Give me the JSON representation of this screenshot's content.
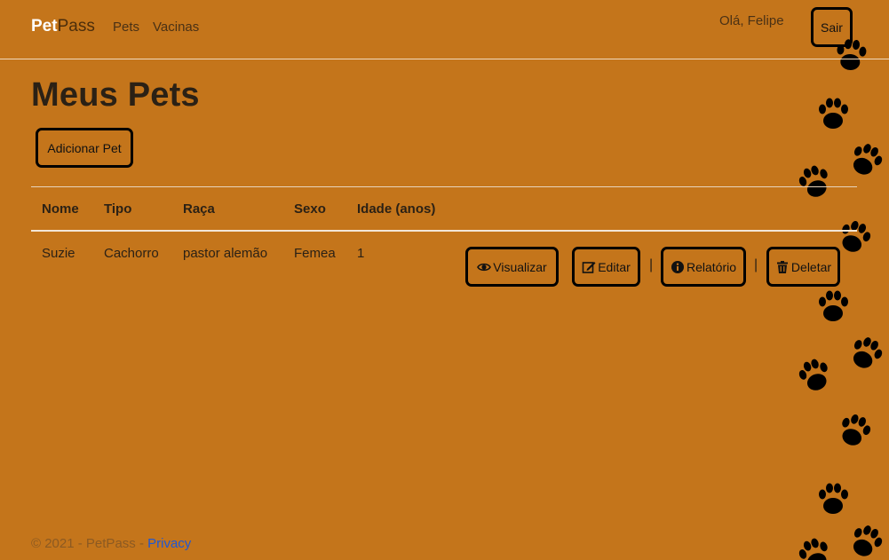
{
  "navbar": {
    "brand_bold": "Pet",
    "brand_rest": "Pass",
    "links": [
      "Pets",
      "Vacinas"
    ],
    "greeting": "Olá, Felipe",
    "logout_label": "Sair"
  },
  "page": {
    "title": "Meus Pets",
    "add_button_label": "Adicionar Pet"
  },
  "table": {
    "headers": [
      "Nome",
      "Tipo",
      "Raça",
      "Sexo",
      "Idade (anos)"
    ],
    "rows": [
      {
        "cells": [
          "Suzie",
          "Cachorro",
          "pastor alemão",
          "Femea",
          "1"
        ],
        "actions": [
          "Visualizar",
          "Editar",
          "Relatório",
          "Deletar"
        ],
        "separator": "|"
      }
    ]
  },
  "footer": {
    "text": "© 2021 - PetPass - ",
    "privacy_label": "Privacy"
  },
  "colors": {
    "background": "#c4751b",
    "link": "#1e57d6"
  },
  "icons": [
    "eye-icon",
    "edit-icon",
    "info-icon",
    "trash-icon",
    "paw-print-icon"
  ]
}
